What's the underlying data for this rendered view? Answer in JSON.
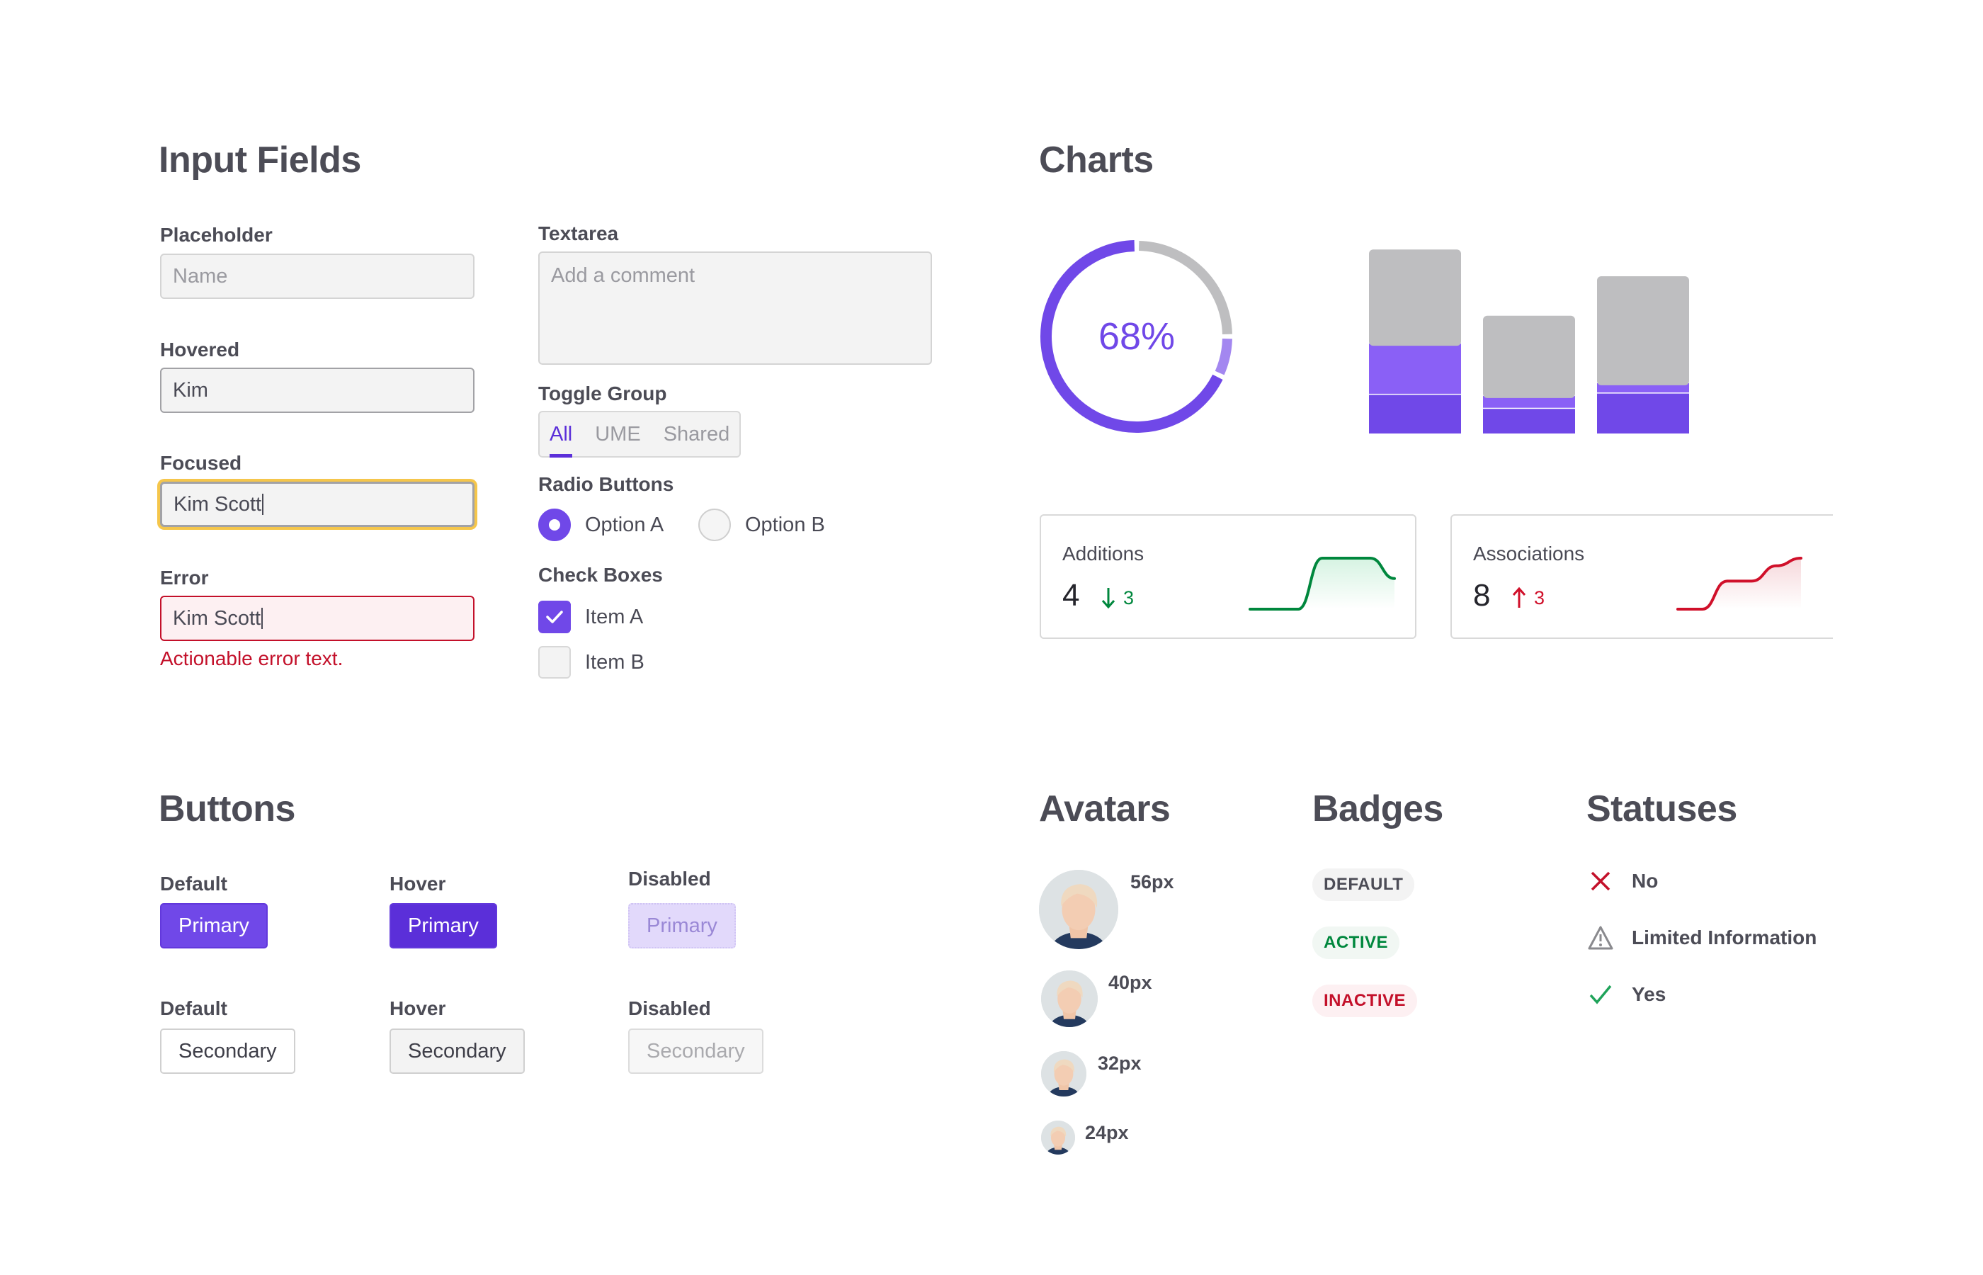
{
  "input_fields": {
    "heading": "Input Fields",
    "placeholder": {
      "label": "Placeholder",
      "placeholder": "Name"
    },
    "hovered": {
      "label": "Hovered",
      "value": "Kim"
    },
    "focused": {
      "label": "Focused",
      "value": "Kim Scott"
    },
    "error": {
      "label": "Error",
      "value": "Kim Scott",
      "message": "Actionable error text."
    },
    "textarea": {
      "label": "Textarea",
      "placeholder": "Add a comment"
    },
    "toggle_group": {
      "label": "Toggle Group",
      "options": [
        "All",
        "UME",
        "Shared"
      ],
      "selected": "All"
    },
    "radio_buttons": {
      "label": "Radio Buttons",
      "options": [
        "Option A",
        "Option B"
      ],
      "selected": "Option A"
    },
    "check_boxes": {
      "label": "Check Boxes",
      "items": [
        {
          "label": "Item A",
          "checked": true
        },
        {
          "label": "Item B",
          "checked": false
        }
      ]
    }
  },
  "charts": {
    "heading": "Charts",
    "donut": {
      "label": "68%",
      "value": 68,
      "secondary": 7,
      "colors": {
        "primary": "#7048e8",
        "secondary": "#a387f0",
        "track": "#bebec0"
      }
    },
    "stacked_bars": {
      "colors": {
        "dark": "#7048e8",
        "light": "#8a60f6",
        "gray": "#bebec0"
      },
      "bars": [
        {
          "dark": 32,
          "light": 41,
          "gray": 73
        },
        {
          "dark": 21,
          "light": 11,
          "gray": 62
        },
        {
          "dark": 33,
          "light": 9,
          "gray": 83
        }
      ]
    },
    "stat_cards": [
      {
        "title": "Additions",
        "value": "4",
        "delta": "3",
        "direction": "down",
        "color": "#00873d",
        "fill": "#d6f3e2",
        "sparkline": [
          0,
          0,
          0,
          1,
          1,
          1,
          0.6
        ]
      },
      {
        "title": "Associations",
        "value": "8",
        "direction": "up",
        "delta": "3",
        "color": "#d0102a",
        "fill": "#f6d8db",
        "sparkline": [
          0,
          0,
          0.55,
          0.55,
          0.85,
          1
        ]
      }
    ]
  },
  "buttons": {
    "heading": "Buttons",
    "primary": [
      {
        "state": "Default",
        "label": "Primary"
      },
      {
        "state": "Hover",
        "label": "Primary"
      },
      {
        "state": "Disabled",
        "label": "Primary"
      }
    ],
    "secondary": [
      {
        "state": "Default",
        "label": "Secondary"
      },
      {
        "state": "Hover",
        "label": "Secondary"
      },
      {
        "state": "Disabled",
        "label": "Secondary"
      }
    ]
  },
  "avatars": {
    "heading": "Avatars",
    "sizes": [
      "56px",
      "40px",
      "32px",
      "24px"
    ]
  },
  "badges": {
    "heading": "Badges",
    "items": [
      "DEFAULT",
      "ACTIVE",
      "INACTIVE"
    ]
  },
  "statuses": {
    "heading": "Statuses",
    "items": [
      {
        "icon": "x-icon",
        "label": "No"
      },
      {
        "icon": "warning-icon",
        "label": "Limited Information"
      },
      {
        "icon": "check-icon",
        "label": "Yes"
      }
    ]
  }
}
